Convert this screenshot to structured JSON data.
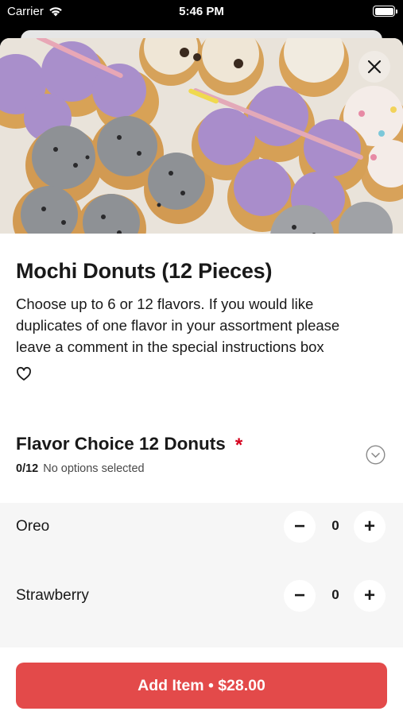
{
  "status_bar": {
    "carrier": "Carrier",
    "time": "5:46 PM"
  },
  "item": {
    "title": "Mochi Donuts (12 Pieces)",
    "description_lines": [
      "Choose up to 6 or 12 flavors. If you would like",
      "duplicates of one flavor in your assortment please",
      "leave a comment in the special instructions box"
    ],
    "hero_image": "mochi-donuts-photo"
  },
  "flavor_section": {
    "title": "Flavor Choice 12 Donuts",
    "required_mark": "*",
    "count": "0/12",
    "status": "No options selected"
  },
  "options": [
    {
      "label": "Oreo",
      "quantity": "0",
      "minus": "−",
      "plus": "+"
    },
    {
      "label": "Strawberry",
      "quantity": "0",
      "minus": "−",
      "plus": "+"
    }
  ],
  "add_button": {
    "label": "Add Item • $28.00"
  },
  "icons": {
    "wifi": "wifi-icon",
    "battery": "battery-icon",
    "close": "close-icon",
    "favorite": "heart-icon",
    "expand": "chevron-down-circle-icon"
  },
  "colors": {
    "accent": "#e34a4a",
    "required": "#d5001c",
    "options_bg": "#f6f6f6"
  }
}
